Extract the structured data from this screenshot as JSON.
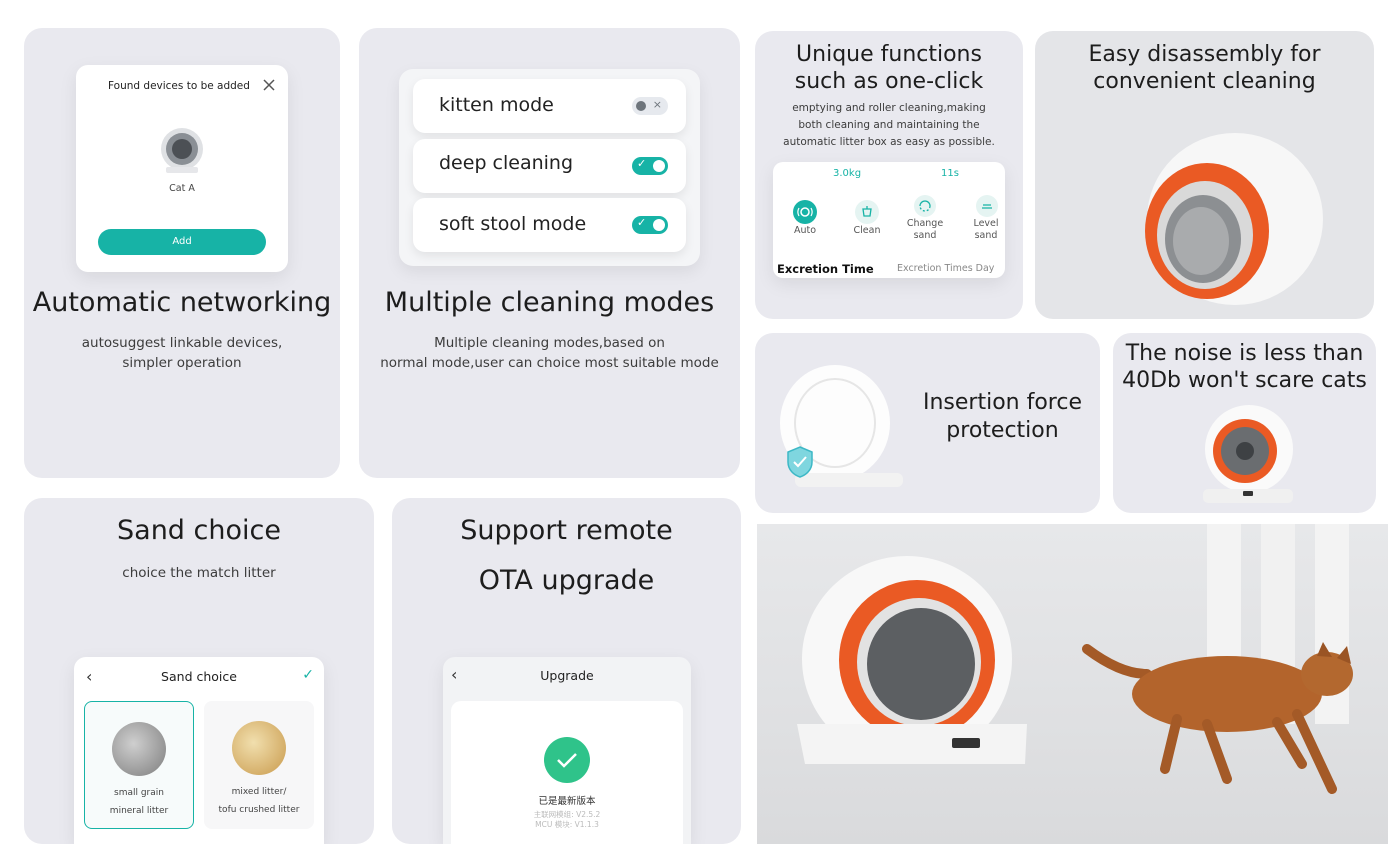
{
  "networking": {
    "title": "Automatic networking",
    "subtitle_line1": "autosuggest  linkable devices,",
    "subtitle_line2": "simpler operation",
    "dialog_title": "Found devices to be added",
    "device_name": "Cat A",
    "add_label": "Add"
  },
  "modes": {
    "title": "Multiple cleaning modes",
    "subtitle_line1": "Multiple cleaning modes,based on",
    "subtitle_line2": "normal mode,user can choice most suitable mode",
    "items": [
      {
        "label": "kitten mode",
        "state": "off"
      },
      {
        "label": "deep cleaning",
        "state": "on"
      },
      {
        "label": "soft stool mode",
        "state": "on"
      }
    ]
  },
  "unique": {
    "title_line1": "Unique functions",
    "title_line2": "such as one-click",
    "desc_line1": "emptying and roller cleaning,making",
    "desc_line2": "both cleaning and maintaining the",
    "desc_line3": "automatic litter box as easy as possible.",
    "weight": "3.0kg",
    "time": "11s",
    "actions": [
      {
        "label1": "Auto",
        "label2": ""
      },
      {
        "label1": "Clean",
        "label2": ""
      },
      {
        "label1": "Change",
        "label2": "sand"
      },
      {
        "label1": "Level",
        "label2": "sand"
      }
    ],
    "footer_left": "Excretion Time",
    "footer_right": "Excretion Times Day"
  },
  "disassembly": {
    "title_line1": "Easy disassembly for",
    "title_line2": "convenient cleaning"
  },
  "insertion": {
    "title_line1": "Insertion force",
    "title_line2": "protection"
  },
  "noise": {
    "title_line1": "The noise is less than",
    "title_line2": "40Db won't scare cats"
  },
  "sand": {
    "title": "Sand choice",
    "subtitle": "choice the match litter",
    "screen_title": "Sand choice",
    "option1_line1": "small grain",
    "option1_line2": "mineral litter",
    "option2_line1": "mixed litter/",
    "option2_line2": "tofu crushed litter"
  },
  "ota": {
    "title_line1": "Support remote",
    "title_line2": "OTA upgrade",
    "screen_title": "Upgrade",
    "status": "已是最新版本",
    "version1": "主联网模组: V2.5.2",
    "version2": "MCU 模块: V1.1.3"
  },
  "colors": {
    "accent": "#17b3a6",
    "orange": "#ea5a24",
    "card_bg": "#e9e9ef"
  }
}
